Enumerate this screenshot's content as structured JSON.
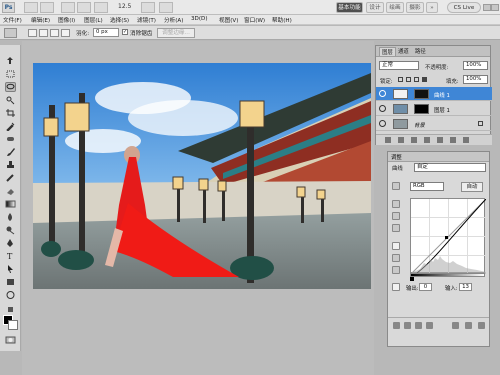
{
  "app": {
    "logo": "Ps",
    "zoom": "12.5",
    "workspaces": [
      "基本功能",
      "设计",
      "绘画",
      "摄影"
    ],
    "account_label": "CS Live"
  },
  "menu": [
    "文件(F)",
    "编辑(E)",
    "图像(I)",
    "图层(L)",
    "选择(S)",
    "滤镜(T)",
    "分析(A)",
    "3D(D)",
    "视图(V)",
    "窗口(W)",
    "帮助(H)"
  ],
  "options": {
    "feather_label": "羽化:",
    "feather_value": "0 px",
    "antialias_label": "消除锯齿",
    "refine_edge_button": "调整边缘..."
  },
  "layers_panel": {
    "tabs": [
      "图层",
      "通道",
      "路径"
    ],
    "blend_mode": "正常",
    "opacity_label": "不透明度:",
    "opacity_value": "100%",
    "lock_label": "锁定:",
    "fill_label": "填充:",
    "fill_value": "100%",
    "layers": [
      {
        "name": "曲线 1",
        "selected": true
      },
      {
        "name": "图层 1",
        "selected": false
      },
      {
        "name": "背景",
        "selected": false
      }
    ]
  },
  "adjustments_panel": {
    "title": "调整",
    "preset_label": "曲线",
    "preset_value": "自定",
    "channel": "RGB",
    "auto_button": "自动",
    "output_label": "输出:",
    "output_value": "0",
    "input_label": "输入:",
    "input_value": "13"
  },
  "colors": {
    "selected_layer": "#3f86d6",
    "appbar_dark": "#4f4f4f",
    "panel_bg": "#d6d6d6"
  },
  "icons": [
    "move-tool-icon",
    "marquee-tool-icon",
    "lasso-tool-icon",
    "quick-select-icon",
    "crop-tool-icon",
    "eyedropper-icon",
    "healing-brush-icon",
    "brush-icon",
    "clone-stamp-icon",
    "history-brush-icon",
    "eraser-icon",
    "gradient-icon",
    "blur-icon",
    "dodge-icon",
    "pen-icon",
    "type-icon",
    "path-select-icon",
    "shape-icon",
    "3d-rotate-icon",
    "3d-orbit-icon",
    "hand-icon",
    "zoom-icon"
  ]
}
